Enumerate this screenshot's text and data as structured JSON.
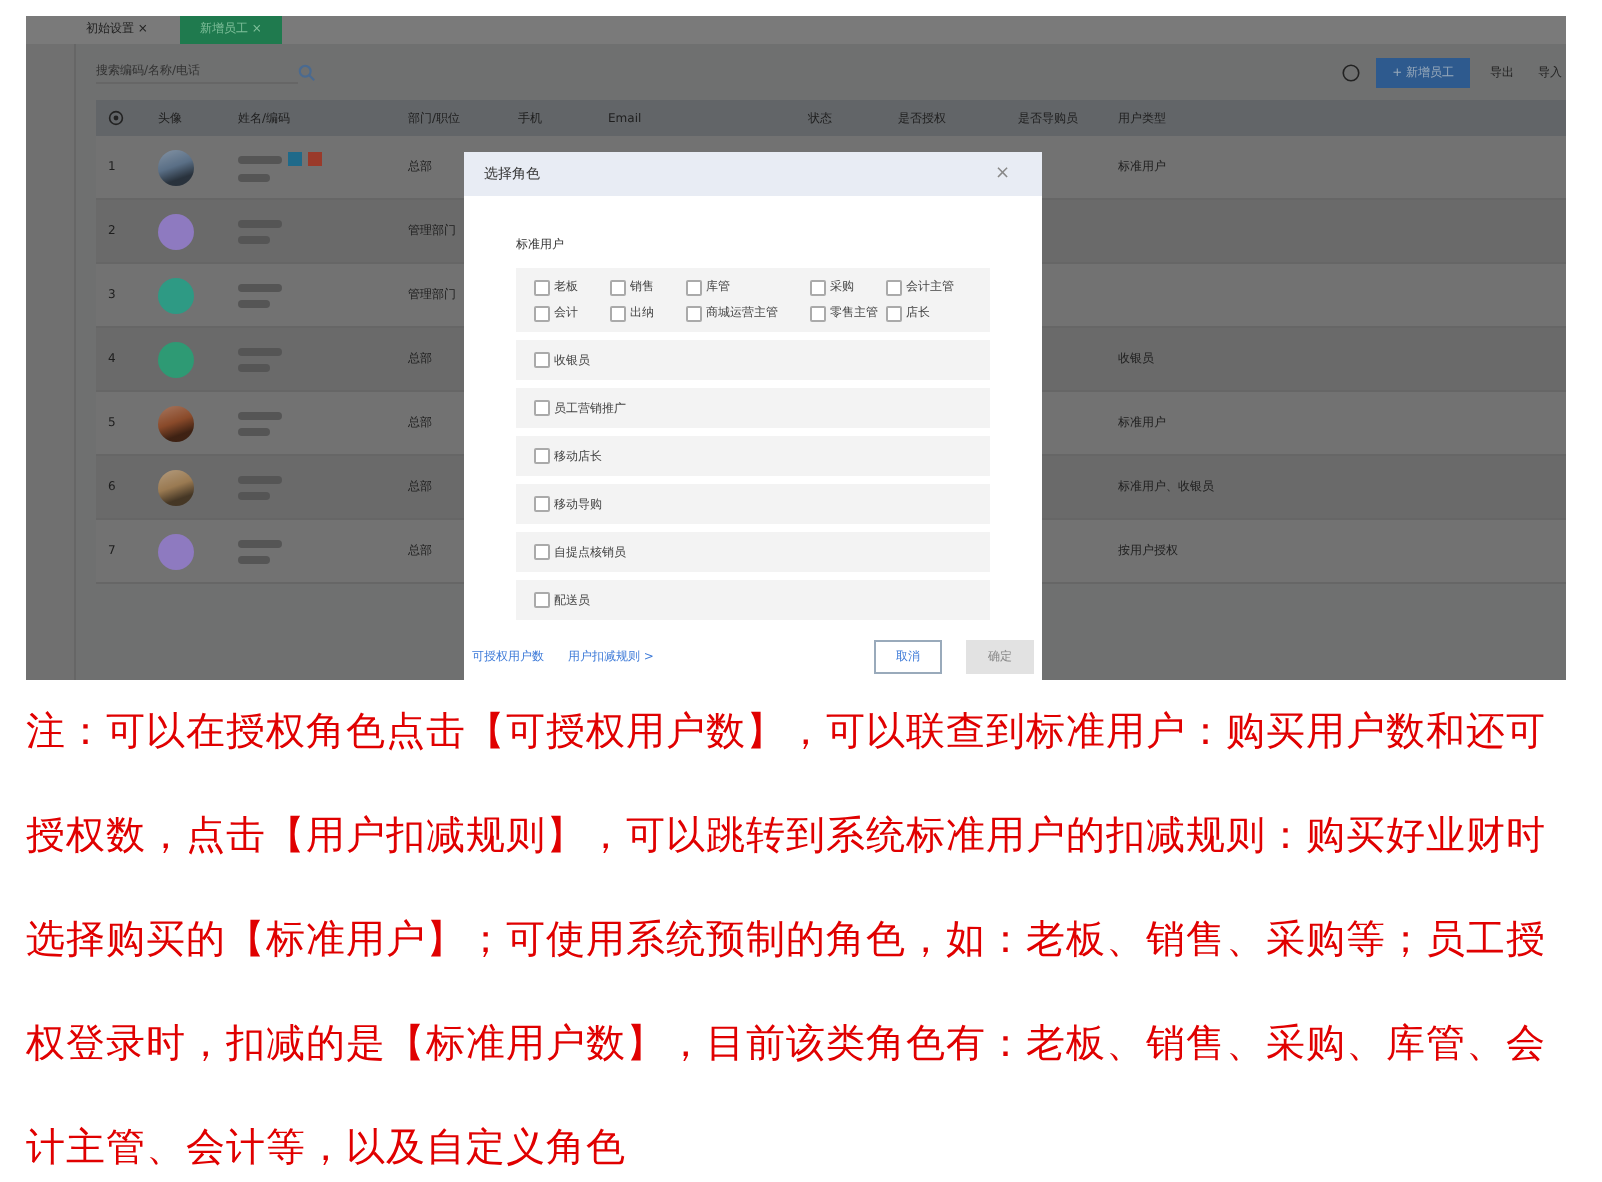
{
  "screenshot": {
    "tabs": [
      {
        "label": "初始设置",
        "close": "×",
        "selected": false
      },
      {
        "label": "新增员工",
        "close": "×",
        "selected": true
      }
    ],
    "search": {
      "placeholder": "搜索编码/名称/电话"
    },
    "toolbar": {
      "add_button": "+ 新增员工",
      "export": "导出",
      "import": "导入"
    },
    "table": {
      "columns": [
        "头像",
        "姓名/编码",
        "部门/职位",
        "手机",
        "Email",
        "状态",
        "是否授权",
        "是否导购员",
        "用户类型"
      ],
      "rows": [
        {
          "index": "1",
          "avatar": {
            "kind": "photo"
          },
          "color": "#5a6f86",
          "badges": true,
          "dept": "总部",
          "user_type": "标准用户"
        },
        {
          "index": "2",
          "avatar": {
            "kind": "circle"
          },
          "color": "#8e7ac0",
          "badges": false,
          "dept": "管理部门"
        },
        {
          "index": "3",
          "avatar": {
            "kind": "circle"
          },
          "color": "#2e9a84",
          "badges": false,
          "dept": "管理部门"
        },
        {
          "index": "4",
          "avatar": {
            "kind": "circle"
          },
          "color": "#2e9a74",
          "badges": false,
          "dept": "总部",
          "user_type": "收银员"
        },
        {
          "index": "5",
          "avatar": {
            "kind": "photo"
          },
          "color": "#8a4a2a",
          "badges": false,
          "dept": "总部",
          "user_type": "标准用户"
        },
        {
          "index": "6",
          "avatar": {
            "kind": "photo"
          },
          "color": "#9a7a52",
          "badges": false,
          "dept": "总部",
          "user_type": "标准用户、收银员"
        },
        {
          "index": "7",
          "avatar": {
            "kind": "circle"
          },
          "color": "#8e7ac0",
          "badges": false,
          "dept": "总部",
          "user_type": "按用户授权"
        }
      ]
    },
    "dialog": {
      "title": "选择角色",
      "close": "×",
      "section": "标准用户",
      "standard_roles": [
        {
          "label": "老板",
          "checked": false
        },
        {
          "label": "销售",
          "checked": false
        },
        {
          "label": "库管",
          "checked": false
        },
        {
          "label": "采购",
          "checked": false
        },
        {
          "label": "会计主管",
          "checked": false
        },
        {
          "label": "会计",
          "checked": false
        },
        {
          "label": "出纳",
          "checked": false
        },
        {
          "label": "商城运营主管",
          "checked": false
        },
        {
          "label": "零售主管",
          "checked": false
        },
        {
          "label": "店长",
          "checked": false
        }
      ],
      "other_roles": [
        {
          "label": "收银员",
          "checked": false
        },
        {
          "label": "员工营销推广",
          "checked": false
        },
        {
          "label": "移动店长",
          "checked": false
        },
        {
          "label": "移动导购",
          "checked": false
        },
        {
          "label": "自提点核销员",
          "checked": false
        },
        {
          "label": "配送员",
          "checked": false
        }
      ],
      "links": [
        "可授权用户数",
        "用户扣减规则 >"
      ],
      "cancel": "取消",
      "confirm": {
        "label": "确定",
        "disabled": true
      }
    }
  },
  "note": "注：可以在授权角色点击【可授权用户数】，可以联查到标准用户：购买用户数和还可授权数，点击【用户扣减规则】，可以跳转到系统标准用户的扣减规则：购买好业财时选择购买的【标准用户】；可使用系统预制的角色，如：老板、销售、采购等；员工授权登录时，扣减的是【标准用户数】，目前该类角色有：老板、销售、采购、库管、会计主管、会计等，以及自定义角色"
}
